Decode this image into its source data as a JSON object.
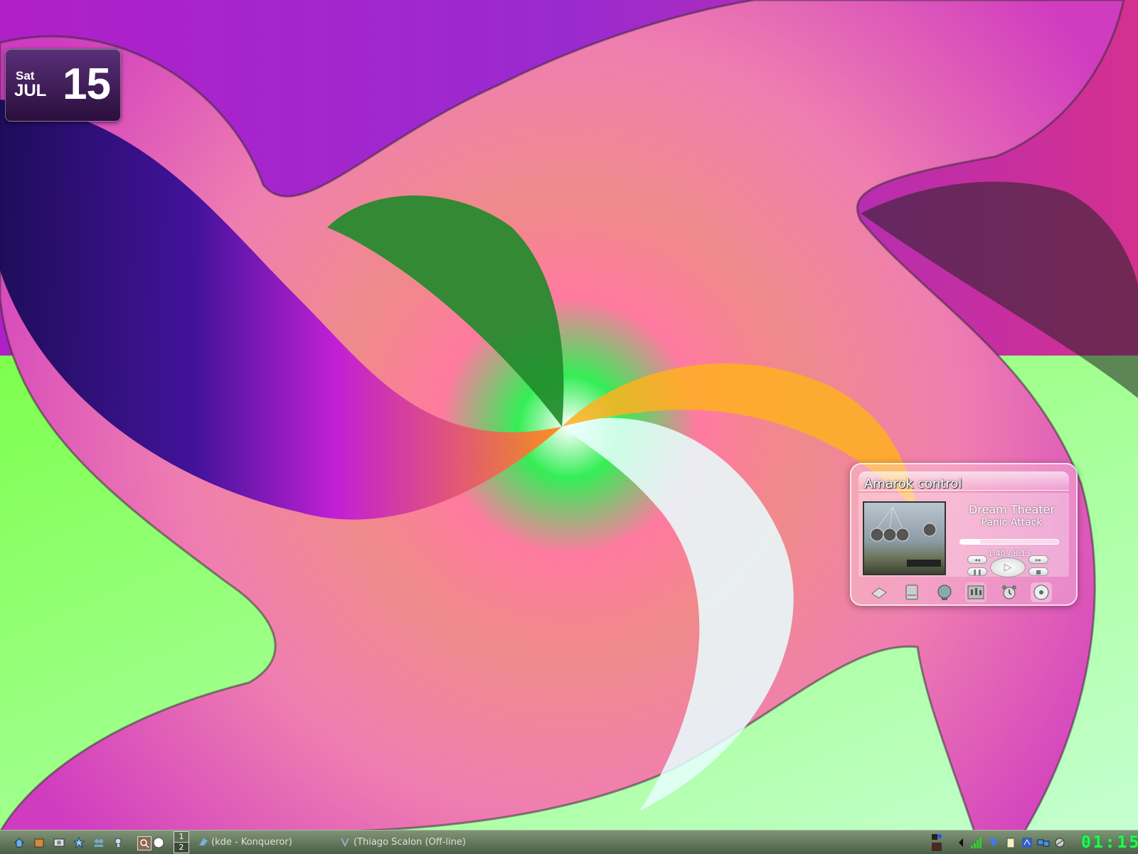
{
  "date_widget": {
    "weekday": "Sat",
    "month": "JUL",
    "day": "15"
  },
  "amarok": {
    "title": "Amarok control",
    "artist": "Dream Theater",
    "track": "Panic Attack",
    "time": "1:40 / 8:13",
    "progress": 0.2,
    "buttons": {
      "previous": "◂◂",
      "next": "▸▸",
      "pause": "❚❚",
      "stop": "■",
      "play": "▷"
    },
    "icons": [
      "drive-icon",
      "hard-disk-icon",
      "globe-icon",
      "mixer-icon",
      "alarm-clock-icon",
      "cd-icon"
    ]
  },
  "taskbar": {
    "pager": [
      "1",
      "2"
    ],
    "tasks": [
      {
        "label": "(kde - Konqueror)",
        "icon": "konqueror-icon"
      },
      {
        "label": "(Thiago Scalon (Off-line)",
        "icon": "chat-icon"
      }
    ],
    "clock": "01:15"
  },
  "colors": {
    "taskbar": "#5f7358",
    "clock": "#22ff44",
    "date_widget": "#3d1b55"
  }
}
